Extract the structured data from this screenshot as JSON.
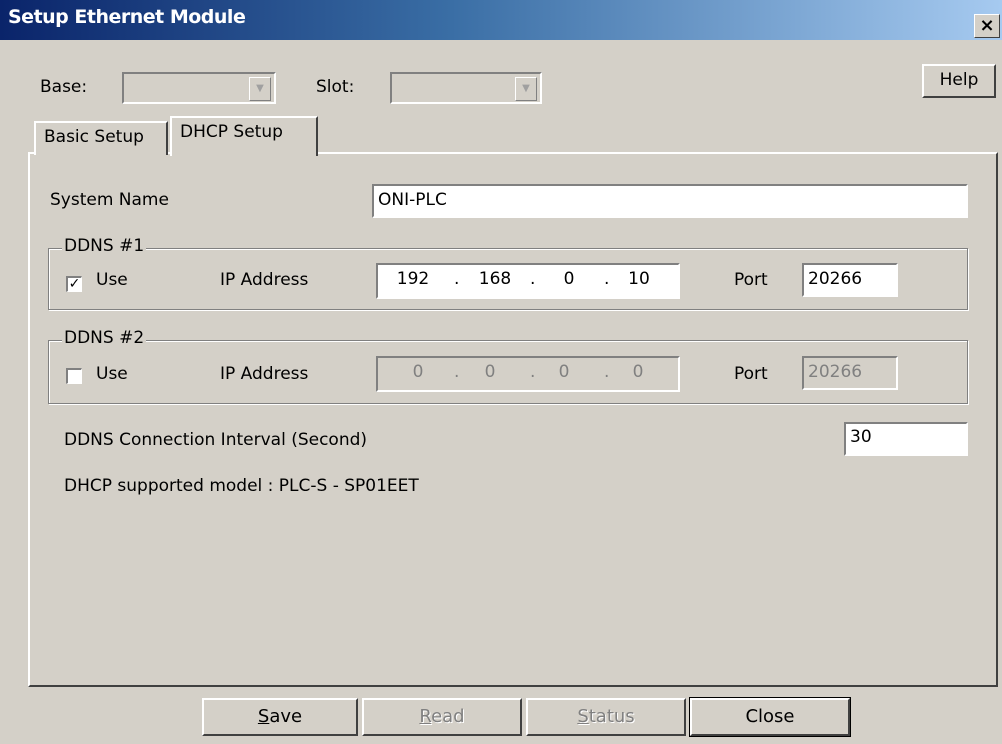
{
  "window": {
    "title": "Setup Ethernet Module",
    "close_glyph": "×"
  },
  "header": {
    "base_label": "Base:",
    "slot_label": "Slot:",
    "base_value": "",
    "slot_value": "",
    "help_label": "Help"
  },
  "tabs": [
    {
      "label": "Basic Setup",
      "active": false
    },
    {
      "label": "DHCP Setup",
      "active": true
    }
  ],
  "dhcp": {
    "system_name_label": "System Name",
    "system_name_value": "ONI-PLC",
    "ddns1": {
      "title": "DDNS #1",
      "use_label": "Use",
      "use_checked": true,
      "ip_label": "IP Address",
      "ip": [
        "192",
        "168",
        "0",
        "10"
      ],
      "port_label": "Port",
      "port_value": "20266"
    },
    "ddns2": {
      "title": "DDNS #2",
      "use_label": "Use",
      "use_checked": false,
      "ip_label": "IP Address",
      "ip": [
        "0",
        "0",
        "0",
        "0"
      ],
      "port_label": "Port",
      "port_value": "20266"
    },
    "interval_label": "DDNS Connection Interval (Second)",
    "interval_value": "30",
    "model_text": "DHCP supported model : PLC-S - SP01EET"
  },
  "buttons": {
    "save_prefix": "S",
    "save_rest": "ave",
    "read_prefix": "R",
    "read_rest": "ead",
    "status_prefix": "S",
    "status_rest": "tatus",
    "close": "Close"
  },
  "icons": {
    "check": "✓",
    "dropdown": "▼",
    "dot": "."
  }
}
